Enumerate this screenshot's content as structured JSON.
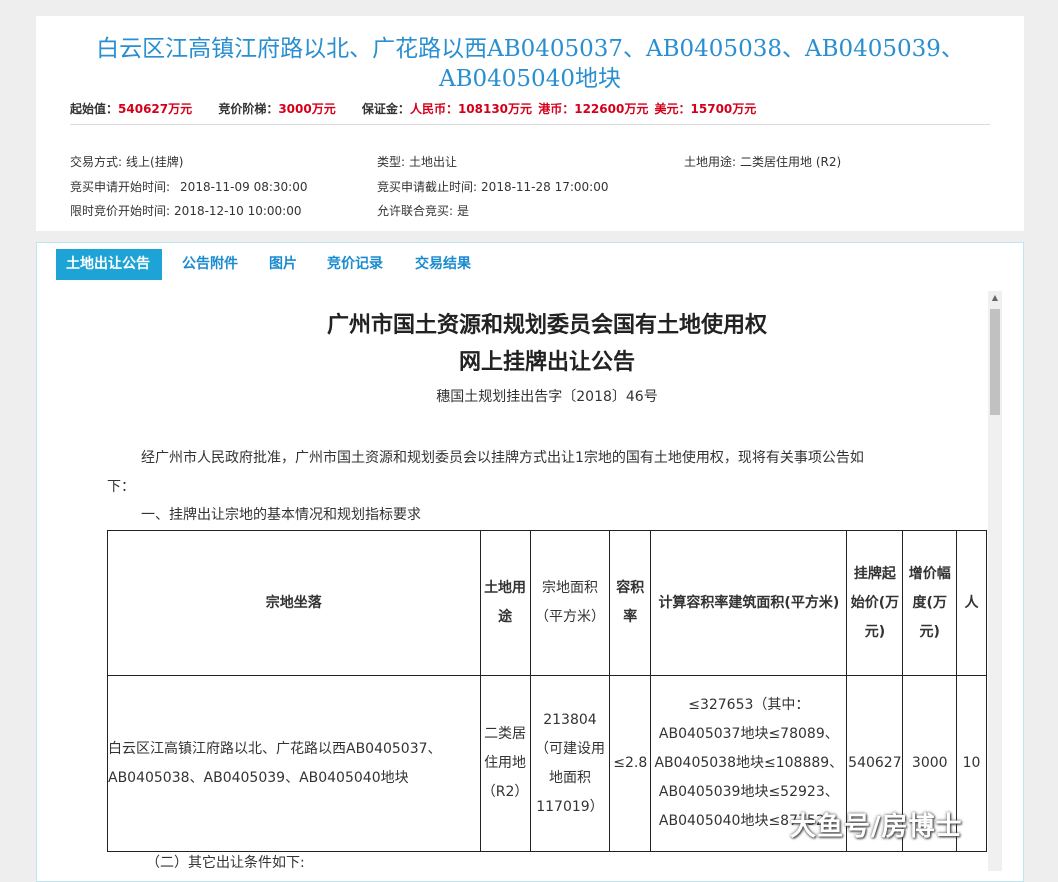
{
  "header": {
    "title_line1": "白云区江高镇江府路以北、广花路以西AB0405037、AB0405038、AB0405039、",
    "title_line2": "AB0405040地块",
    "start_price_label": "起始值：",
    "start_price": "540627万元",
    "bid_step_label": "竞价阶梯：",
    "bid_step": "3000万元",
    "deposit_label": "保证金：",
    "deposit_rmb": "人民币：108130万元",
    "deposit_hkd": "港币：122600万元",
    "deposit_usd": "美元：15700万元"
  },
  "info": {
    "trade_mode_label": "交易方式:",
    "trade_mode": "线上(挂牌)",
    "type_label": "类型:",
    "type": "土地出让",
    "land_use_label": "土地用途:",
    "land_use": "二类居住用地 (R2)",
    "apply_start_label": "竞买申请开始时间:",
    "apply_start": "2018-11-09 08:30:00",
    "apply_end_label": "竞买申请截止时间:",
    "apply_end": "2018-11-28 17:00:00",
    "bid_start_label": "限时竞价开始时间:",
    "bid_start": "2018-12-10 10:00:00",
    "joint_label": "允许联合竞买:",
    "joint": "是"
  },
  "tabs": [
    "土地出让公告",
    "公告附件",
    "图片",
    "竞价记录",
    "交易结果"
  ],
  "doc": {
    "title_line1": "广州市国土资源和规划委员会国有土地使用权",
    "title_line2": "网上挂牌出让公告",
    "doc_no": "穗国土规划挂出告字〔2018〕46号",
    "intro_line1": "经广州市人民政府批准，广州市国土资源和规划委员会以挂牌方式出让1宗地的国有土地使用权，现将有关事项公告如",
    "intro_line2": "下：",
    "section1": "一、挂牌出让宗地的基本情况和规划指标要求",
    "section2": "（二）其它出让条件如下:"
  },
  "table": {
    "headers": {
      "location": "宗地坐落",
      "use": "土地用途",
      "area": "宗地面积（平方米）",
      "far": "容积率",
      "calc_area": "计算容积率建筑面积(平方米)",
      "start_price": "挂牌起始价(万元)",
      "increment": "增价幅度(万元)",
      "extra": "人"
    },
    "row": {
      "location": "白云区江高镇江府路以北、广花路以西AB0405037、AB0405038、AB0405039、AB0405040地块",
      "use": "二类居住用地（R2）",
      "area": "213804（可建设用地面积117019）",
      "far": "≤2.8",
      "calc_area": "≤327653（其中：AB0405037地块≤78089、AB0405038地块≤108889、AB0405039地块≤52923、AB0405040地块≤87752）",
      "start_price": "540627",
      "increment": "3000",
      "extra": "10"
    }
  },
  "watermark": "大鱼号/房博士",
  "colors": {
    "title_blue": "#2a8fd0",
    "price_red": "#d4001a",
    "tab_active_bg": "#1da3d5",
    "tab_text": "#1b8bd0"
  }
}
